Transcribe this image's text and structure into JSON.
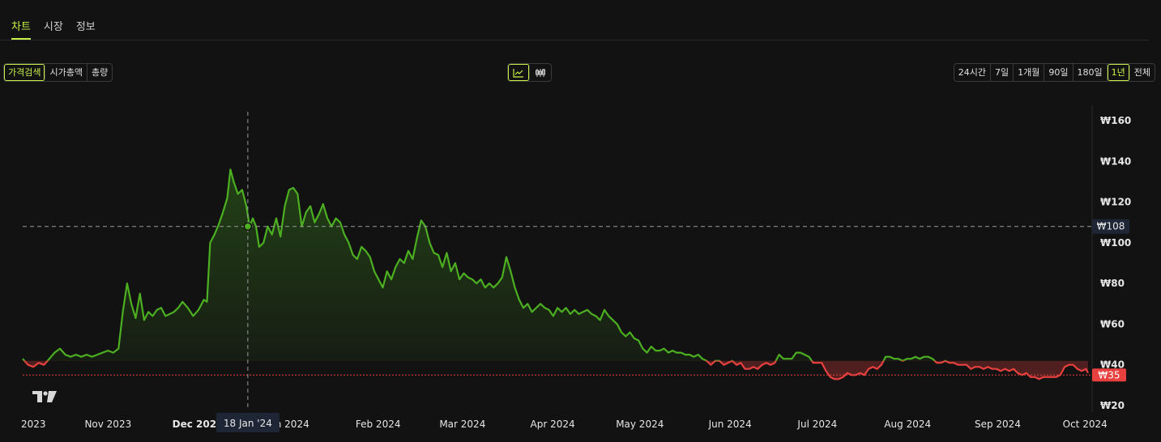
{
  "tabs": [
    {
      "label": "차트",
      "active": true
    },
    {
      "label": "시장",
      "active": false
    },
    {
      "label": "정보",
      "active": false
    }
  ],
  "metric_buttons": [
    {
      "label": "가격검색",
      "active": true
    },
    {
      "label": "시가총액",
      "active": false
    },
    {
      "label": "총량",
      "active": false
    }
  ],
  "chart_style_buttons": [
    {
      "icon": "line-chart-icon",
      "active": true
    },
    {
      "icon": "candlestick-icon",
      "active": false
    }
  ],
  "range_buttons": [
    {
      "label": "24시간",
      "active": false
    },
    {
      "label": "7일",
      "active": false
    },
    {
      "label": "1개월",
      "active": false
    },
    {
      "label": "90일",
      "active": false
    },
    {
      "label": "180일",
      "active": false
    },
    {
      "label": "1년",
      "active": true
    },
    {
      "label": "전체",
      "active": false
    }
  ],
  "colors": {
    "accent": "#c8f24a",
    "up": "#4caf22",
    "down": "#e8403f",
    "crosshair_label_bg": "#1e2636"
  },
  "watermark": "tradingview-logo-icon",
  "chart_data": {
    "type": "line",
    "y_ticks": [
      "₩160",
      "₩140",
      "₩120",
      "₩100",
      "₩80",
      "₩60",
      "₩40",
      "₩20"
    ],
    "y_tick_values": [
      160,
      140,
      120,
      100,
      80,
      60,
      40,
      20
    ],
    "ylim": [
      17,
      165
    ],
    "x_ticks": [
      "2023",
      "Nov 2023",
      "Dec 2023",
      "Jan 2024",
      "Feb 2024",
      "Mar 2024",
      "Apr 2024",
      "May 2024",
      "Jun 2024",
      "Jul 2024",
      "Aug 2024",
      "Sep 2024",
      "Oct 2024"
    ],
    "x_tick_t": [
      0.0,
      0.0801,
      0.1643,
      0.2489,
      0.3336,
      0.4128,
      0.4974,
      0.5793,
      0.664,
      0.7459,
      0.8306,
      0.9152,
      0.9971
    ],
    "baseline_value": 42,
    "current_price": {
      "label": "₩35",
      "value": 35
    },
    "crosshair": {
      "x_label": "18 Jan '24",
      "y_label": "₩108",
      "t": 0.2113,
      "value": 108
    },
    "series": [
      {
        "values": [
          [
            0,
            43
          ],
          [
            0.005,
            40
          ],
          [
            0.01,
            39
          ],
          [
            0.015,
            41
          ],
          [
            0.02,
            40
          ],
          [
            0.025,
            43
          ],
          [
            0.03,
            46
          ],
          [
            0.035,
            48
          ],
          [
            0.04,
            45
          ],
          [
            0.045,
            44
          ],
          [
            0.05,
            45
          ],
          [
            0.055,
            44
          ],
          [
            0.06,
            45
          ],
          [
            0.065,
            44
          ],
          [
            0.07,
            45
          ],
          [
            0.075,
            46
          ],
          [
            0.08,
            47
          ],
          [
            0.085,
            46
          ],
          [
            0.09,
            48
          ],
          [
            0.094,
            66
          ],
          [
            0.098,
            80
          ],
          [
            0.102,
            70
          ],
          [
            0.106,
            63
          ],
          [
            0.11,
            75
          ],
          [
            0.114,
            62
          ],
          [
            0.118,
            66
          ],
          [
            0.122,
            64
          ],
          [
            0.126,
            67
          ],
          [
            0.13,
            68
          ],
          [
            0.134,
            64
          ],
          [
            0.138,
            65
          ],
          [
            0.142,
            66
          ],
          [
            0.146,
            68
          ],
          [
            0.15,
            71
          ],
          [
            0.155,
            68
          ],
          [
            0.16,
            64
          ],
          [
            0.165,
            67
          ],
          [
            0.17,
            72
          ],
          [
            0.173,
            71
          ],
          [
            0.176,
            100
          ],
          [
            0.18,
            104
          ],
          [
            0.184,
            109
          ],
          [
            0.188,
            115
          ],
          [
            0.192,
            122
          ],
          [
            0.195,
            136
          ],
          [
            0.198,
            130
          ],
          [
            0.202,
            124
          ],
          [
            0.206,
            126
          ],
          [
            0.21,
            118
          ],
          [
            0.213,
            108
          ],
          [
            0.216,
            112
          ],
          [
            0.219,
            108
          ],
          [
            0.222,
            98
          ],
          [
            0.226,
            100
          ],
          [
            0.23,
            108
          ],
          [
            0.234,
            104
          ],
          [
            0.238,
            112
          ],
          [
            0.242,
            103
          ],
          [
            0.246,
            118
          ],
          [
            0.25,
            126
          ],
          [
            0.254,
            127
          ],
          [
            0.258,
            124
          ],
          [
            0.262,
            108
          ],
          [
            0.266,
            115
          ],
          [
            0.27,
            118
          ],
          [
            0.274,
            110
          ],
          [
            0.278,
            114
          ],
          [
            0.282,
            119
          ],
          [
            0.286,
            112
          ],
          [
            0.29,
            108
          ],
          [
            0.294,
            112
          ],
          [
            0.298,
            110
          ],
          [
            0.302,
            104
          ],
          [
            0.306,
            100
          ],
          [
            0.31,
            94
          ],
          [
            0.314,
            92
          ],
          [
            0.318,
            98
          ],
          [
            0.322,
            96
          ],
          [
            0.326,
            93
          ],
          [
            0.33,
            86
          ],
          [
            0.334,
            82
          ],
          [
            0.338,
            78
          ],
          [
            0.342,
            86
          ],
          [
            0.346,
            82
          ],
          [
            0.35,
            88
          ],
          [
            0.354,
            92
          ],
          [
            0.358,
            90
          ],
          [
            0.362,
            96
          ],
          [
            0.366,
            92
          ],
          [
            0.37,
            102
          ],
          [
            0.374,
            111
          ],
          [
            0.378,
            108
          ],
          [
            0.382,
            100
          ],
          [
            0.386,
            95
          ],
          [
            0.39,
            94
          ],
          [
            0.394,
            88
          ],
          [
            0.398,
            95
          ],
          [
            0.402,
            86
          ],
          [
            0.406,
            90
          ],
          [
            0.41,
            82
          ],
          [
            0.414,
            85
          ],
          [
            0.418,
            83
          ],
          [
            0.422,
            82
          ],
          [
            0.426,
            80
          ],
          [
            0.43,
            82
          ],
          [
            0.434,
            78
          ],
          [
            0.438,
            80
          ],
          [
            0.442,
            78
          ],
          [
            0.446,
            80
          ],
          [
            0.45,
            83
          ],
          [
            0.454,
            93
          ],
          [
            0.458,
            86
          ],
          [
            0.462,
            78
          ],
          [
            0.466,
            72
          ],
          [
            0.47,
            68
          ],
          [
            0.474,
            70
          ],
          [
            0.478,
            66
          ],
          [
            0.482,
            68
          ],
          [
            0.486,
            70
          ],
          [
            0.49,
            68
          ],
          [
            0.494,
            67
          ],
          [
            0.498,
            64
          ],
          [
            0.502,
            68
          ],
          [
            0.506,
            66
          ],
          [
            0.51,
            68
          ],
          [
            0.514,
            65
          ],
          [
            0.518,
            67
          ],
          [
            0.522,
            65
          ],
          [
            0.526,
            66
          ],
          [
            0.53,
            67
          ],
          [
            0.534,
            65
          ],
          [
            0.538,
            64
          ],
          [
            0.542,
            62
          ],
          [
            0.546,
            67
          ],
          [
            0.55,
            64
          ],
          [
            0.554,
            62
          ],
          [
            0.558,
            60
          ],
          [
            0.562,
            56
          ],
          [
            0.566,
            54
          ],
          [
            0.57,
            56
          ],
          [
            0.574,
            53
          ],
          [
            0.578,
            52
          ],
          [
            0.582,
            48
          ],
          [
            0.586,
            46
          ],
          [
            0.59,
            49
          ],
          [
            0.594,
            47
          ],
          [
            0.598,
            47
          ],
          [
            0.602,
            48
          ],
          [
            0.606,
            46
          ],
          [
            0.61,
            47
          ],
          [
            0.614,
            46
          ],
          [
            0.618,
            46
          ],
          [
            0.622,
            45
          ],
          [
            0.626,
            45
          ],
          [
            0.63,
            44
          ],
          [
            0.634,
            45
          ],
          [
            0.638,
            43
          ],
          [
            0.642,
            42
          ],
          [
            0.646,
            40
          ],
          [
            0.65,
            42
          ],
          [
            0.654,
            42
          ],
          [
            0.658,
            40
          ],
          [
            0.662,
            41
          ],
          [
            0.666,
            42
          ],
          [
            0.67,
            40
          ],
          [
            0.674,
            41
          ],
          [
            0.678,
            38
          ],
          [
            0.682,
            38
          ],
          [
            0.686,
            39
          ],
          [
            0.69,
            38
          ],
          [
            0.694,
            40
          ],
          [
            0.698,
            41
          ],
          [
            0.702,
            40
          ],
          [
            0.706,
            41
          ],
          [
            0.71,
            45
          ],
          [
            0.714,
            43
          ],
          [
            0.718,
            43
          ],
          [
            0.722,
            43
          ],
          [
            0.726,
            46
          ],
          [
            0.73,
            46
          ],
          [
            0.734,
            45
          ],
          [
            0.738,
            44
          ],
          [
            0.742,
            41
          ],
          [
            0.746,
            41
          ],
          [
            0.75,
            41
          ],
          [
            0.754,
            37
          ],
          [
            0.758,
            34
          ],
          [
            0.762,
            33
          ],
          [
            0.766,
            33
          ],
          [
            0.77,
            34
          ],
          [
            0.774,
            36
          ],
          [
            0.778,
            35
          ],
          [
            0.782,
            35
          ],
          [
            0.786,
            36
          ],
          [
            0.79,
            35
          ],
          [
            0.794,
            38
          ],
          [
            0.798,
            39
          ],
          [
            0.802,
            38
          ],
          [
            0.806,
            40
          ],
          [
            0.81,
            44
          ],
          [
            0.814,
            44
          ],
          [
            0.818,
            43
          ],
          [
            0.822,
            43
          ],
          [
            0.826,
            42
          ],
          [
            0.83,
            43
          ],
          [
            0.834,
            43
          ],
          [
            0.838,
            44
          ],
          [
            0.842,
            43
          ],
          [
            0.846,
            44
          ],
          [
            0.85,
            44
          ],
          [
            0.854,
            43
          ],
          [
            0.858,
            41
          ],
          [
            0.862,
            41
          ],
          [
            0.866,
            42
          ],
          [
            0.87,
            41
          ],
          [
            0.874,
            41
          ],
          [
            0.878,
            40
          ],
          [
            0.882,
            40
          ],
          [
            0.886,
            40
          ],
          [
            0.89,
            38
          ],
          [
            0.894,
            39
          ],
          [
            0.898,
            39
          ],
          [
            0.902,
            38
          ],
          [
            0.906,
            39
          ],
          [
            0.91,
            38
          ],
          [
            0.914,
            38
          ],
          [
            0.918,
            37
          ],
          [
            0.922,
            38
          ],
          [
            0.926,
            37
          ],
          [
            0.93,
            38
          ],
          [
            0.934,
            36
          ],
          [
            0.938,
            35
          ],
          [
            0.942,
            36
          ],
          [
            0.946,
            34
          ],
          [
            0.95,
            34
          ],
          [
            0.954,
            33
          ],
          [
            0.958,
            34
          ],
          [
            0.962,
            34
          ],
          [
            0.966,
            34
          ],
          [
            0.97,
            34
          ],
          [
            0.974,
            35
          ],
          [
            0.978,
            39
          ],
          [
            0.982,
            40
          ],
          [
            0.986,
            40
          ],
          [
            0.99,
            38
          ],
          [
            0.994,
            37
          ],
          [
            0.998,
            38
          ],
          [
            1.0,
            36
          ]
        ]
      }
    ]
  }
}
